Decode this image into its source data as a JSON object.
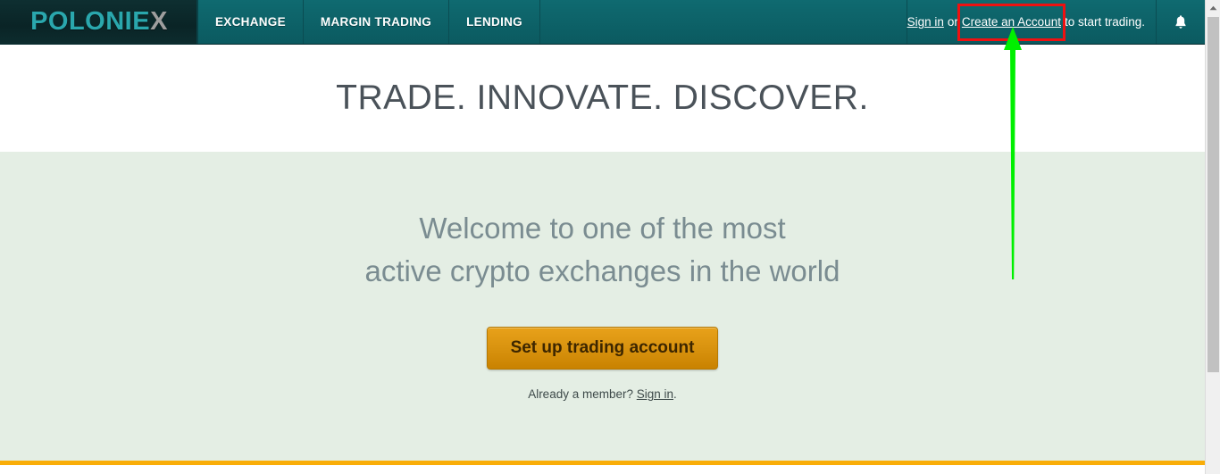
{
  "site": {
    "logo": {
      "main": "POLONIE",
      "accent": "X",
      "accent_color": "#9e9e9e",
      "brand_color": "#2aa7ad"
    }
  },
  "topnav": {
    "items": [
      {
        "label": "EXCHANGE",
        "name": "nav-exchange"
      },
      {
        "label": "MARGIN TRADING",
        "name": "nav-margin-trading"
      },
      {
        "label": "LENDING",
        "name": "nav-lending"
      }
    ],
    "right": {
      "sign_in_label": "Sign in",
      "or_label": "or",
      "create_account_label": "Create an Account",
      "trailing_label": "to start trading.",
      "bell_icon": "bell-icon"
    },
    "bg_color": "#0d6268",
    "logo_bg_color": "#0d2c2e"
  },
  "hero": {
    "title": "TRADE. INNOVATE. DISCOVER.",
    "bg_color": "#ffffff",
    "text_color": "#4a5259"
  },
  "welcome": {
    "line1": "Welcome to one of the most",
    "line2": "active crypto exchanges in the world",
    "cta_label": "Set up trading account",
    "member_prefix": "Already a member?",
    "member_link": "Sign in",
    "member_suffix": ".",
    "bg_color": "#e4eee4",
    "text_color": "#7a8c91",
    "cta_color": "#d9930f"
  },
  "footer": {
    "rule_color": "#f9ad08"
  },
  "annotation": {
    "highlight_color": "#ee1111",
    "arrow_color": "#00f000",
    "target_label": "Create an Account"
  },
  "scrollbar": {
    "up_arrow_icon": "scroll-up-arrow-icon",
    "thumb": "scrollbar-thumb"
  }
}
